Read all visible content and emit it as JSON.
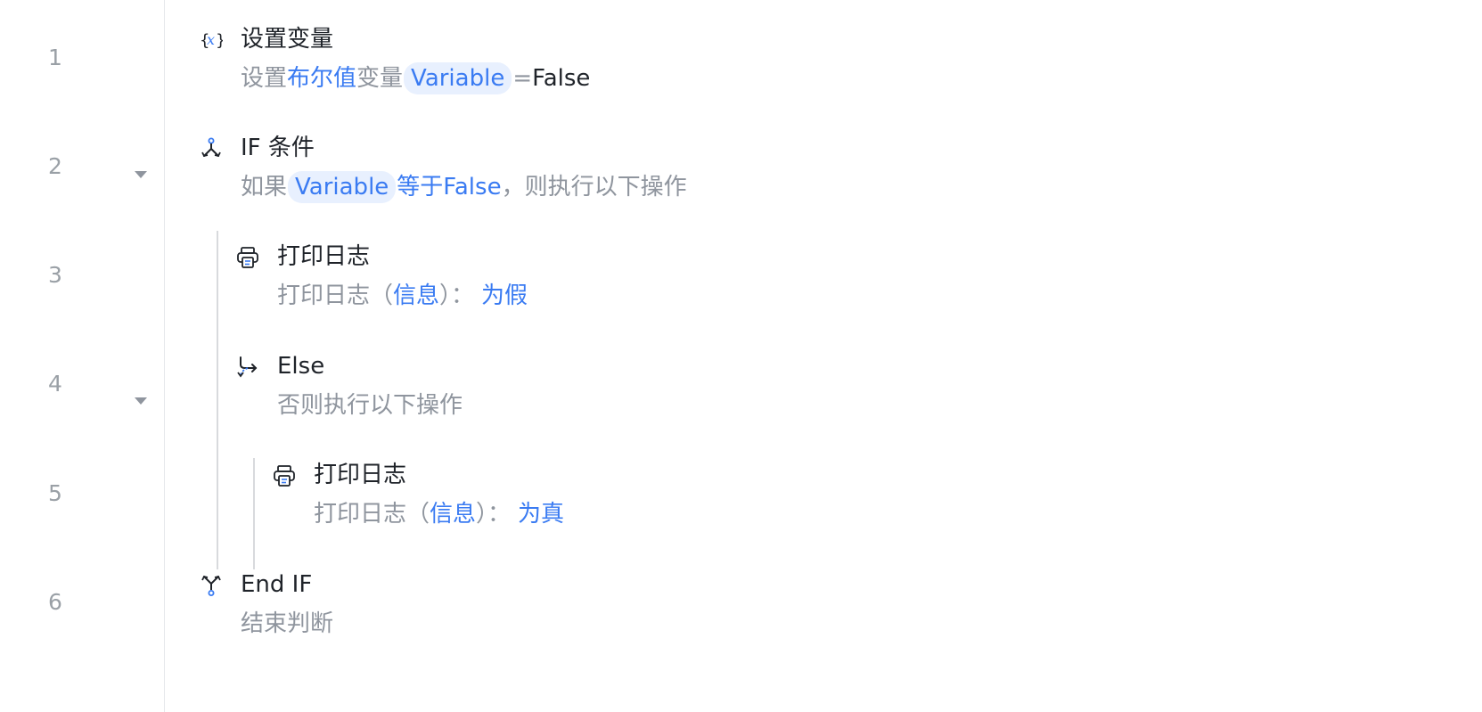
{
  "line_numbers": [
    "1",
    "2",
    "3",
    "4",
    "5",
    "6"
  ],
  "steps": [
    {
      "title": "设置变量",
      "desc": {
        "p1": "设置",
        "p2": "布尔值",
        "p3": "变量",
        "var": "Variable",
        "p4": "=",
        "p5": "False"
      },
      "icon": "variable-icon"
    },
    {
      "title": "IF 条件",
      "desc": {
        "p1": "如果",
        "var": "Variable",
        "p2": "等于False",
        "p3": "，则执行以下操作"
      },
      "icon": "if-branch-icon"
    },
    {
      "title": "打印日志",
      "desc": {
        "p1": "打印日志（",
        "p2": "信息",
        "p3": "）：",
        "p4": "为假"
      },
      "icon": "print-icon"
    },
    {
      "title": "Else",
      "desc": {
        "p1": "否则执行以下操作"
      },
      "icon": "else-branch-icon"
    },
    {
      "title": "打印日志",
      "desc": {
        "p1": "打印日志（",
        "p2": "信息",
        "p3": "）：",
        "p4": "为真"
      },
      "icon": "print-icon"
    },
    {
      "title": "End IF",
      "desc": {
        "p1": "结束判断"
      },
      "icon": "end-if-icon"
    }
  ],
  "colors": {
    "accent": "#3a7bf2",
    "text": "#1f2329",
    "muted": "#8f959e",
    "chip_bg": "#e8f0fe"
  }
}
